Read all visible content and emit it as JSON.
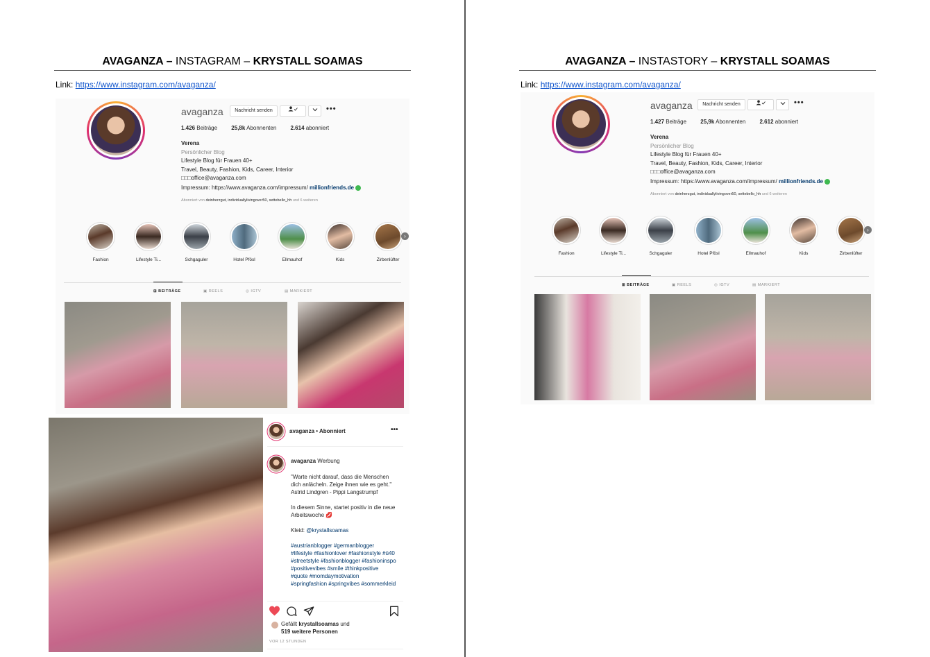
{
  "left": {
    "title_brand": "AVAGANZA –",
    "title_platform": " INSTAGRAM – ",
    "title_client": "KRYSTALL SOAMAS",
    "link_label": "Link: ",
    "link_url": "https://www.instagram.com/avaganza/",
    "profile": {
      "username": "avaganza",
      "message_button": "Nachricht senden",
      "follow_icon": "person-check-icon",
      "more": "•••",
      "posts": "1.426",
      "posts_label": " Beiträge",
      "followers": "25,8k",
      "followers_label": " Abonnenten",
      "following": "2.614",
      "following_label": " abonniert",
      "name": "Verena",
      "category": "Persönlicher Blog",
      "bio1": "Lifestyle Blog für Frauen 40+",
      "bio2": "Travel, Beauty, Fashion, Kids, Career, Interior",
      "bio3": "□□□office@avaganza.com",
      "impressum": "Impressum: https://www.avaganza.com/impressum/ ",
      "million": "millionfriends.de",
      "followed_prefix": "Abonniert von ",
      "followed_names": "deinherzgut, individuallylivingover50, settebello_hh",
      "followed_suffix": " und 6 weiteren",
      "highlights": [
        "Fashion",
        "Lifestyle Ti...",
        "Schgaguler",
        "Hotel Pfösl",
        "Ellmauhof",
        "Kids",
        "Zirbenlüfter"
      ],
      "tabs": [
        "BEITRÄGE",
        "REELS",
        "IGTV",
        "MARKIERT"
      ]
    },
    "post": {
      "username": "avaganza",
      "follow_status": " • Abonniert",
      "more": "•••",
      "caption_name": "avaganza",
      "caption_tag": " Werbung",
      "quote": "\"Warte nicht darauf, dass die Menschen dich anlächeln. Zeige ihnen wie es geht.\" Astrid Lindgren - Pippi Langstrumpf",
      "line2": "In diesem Sinne, startet positiv in die neue Arbeitswoche 💋",
      "kleid": "Kleid: ",
      "kleid_tag": "@krystallsoamas",
      "hashtags": "#austrianblogger #germanblogger #lifestyle #fashionlover #fashionstyle #ü40 #streetstyle #fashionblogger #fashioninspo #positivevibes #smile #thinkpositive #quote #momdaymotivation #springfashion #springvibes #sommerkleid",
      "likes_prefix": "Gefällt ",
      "likes_user": "krystallsoamas",
      "likes_mid": " und",
      "likes_more": "519 weitere Personen",
      "time": "VOR 12 STUNDEN"
    }
  },
  "right": {
    "title_brand": "AVAGANZA –",
    "title_platform": " INSTASTORY – ",
    "title_client": "KRYSTALL SOAMAS",
    "link_label": "Link: ",
    "link_url": "https://www.instagram.com/avaganza/",
    "profile": {
      "username": "avaganza",
      "message_button": "Nachricht senden",
      "follow_icon": "person-check-icon",
      "more": "•••",
      "posts": "1.427",
      "posts_label": " Beiträge",
      "followers": "25,9k",
      "followers_label": " Abonnenten",
      "following": "2.612",
      "following_label": " abonniert",
      "name": "Verena",
      "category": "Persönlicher Blog",
      "bio1": "Lifestyle Blog für Frauen 40+",
      "bio2": "Travel, Beauty, Fashion, Kids, Career, Interior",
      "bio3": "□□□office@avaganza.com",
      "impressum": "Impressum: https://www.avaganza.com/impressum/ ",
      "million": "millionfriends.de",
      "followed_prefix": "Abonniert von ",
      "followed_names": "deinherzgut, individuallylivingover50, settebello_hh",
      "followed_suffix": " und 6 weiteren",
      "highlights": [
        "Fashion",
        "Lifestyle Ti...",
        "Schgaguler",
        "Hotel Pfösl",
        "Ellmauhof",
        "Kids",
        "Zirbenlüfter"
      ],
      "tabs": [
        "BEITRÄGE",
        "REELS",
        "IGTV",
        "MARKIERT"
      ]
    }
  },
  "colors": {
    "link": "#1155cc",
    "instagram_blue": "#00376b",
    "like_red": "#ed4956",
    "verified": "#3fb950"
  }
}
